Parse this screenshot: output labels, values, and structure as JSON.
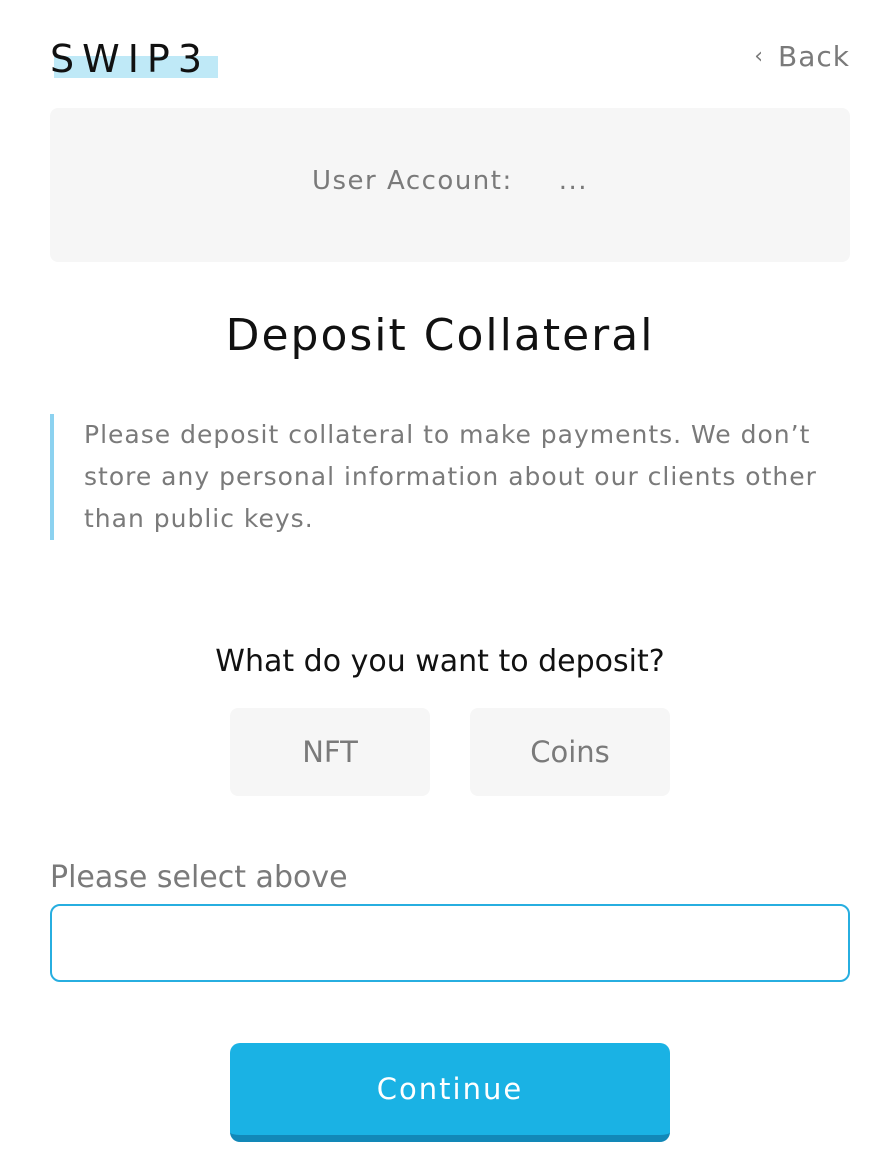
{
  "header": {
    "logo": "SWIP3",
    "back_label": "Back"
  },
  "account": {
    "label": "User Account:",
    "value": "..."
  },
  "page_title": "Deposit Collateral",
  "notice": {
    "text": "Please deposit collateral to make payments. We don’t store any personal information about our clients other than public keys."
  },
  "deposit": {
    "question": "What do you want to deposit?",
    "options": [
      "NFT",
      "Coins"
    ]
  },
  "select": {
    "label": "Please select above",
    "value": ""
  },
  "actions": {
    "continue_label": "Continue"
  },
  "colors": {
    "accent": "#1ab2e4",
    "accent_dark": "#1288b8",
    "logo_highlight": "#bfe9f7",
    "card_bg": "#f6f6f6",
    "muted_text": "#7a7a7a"
  }
}
